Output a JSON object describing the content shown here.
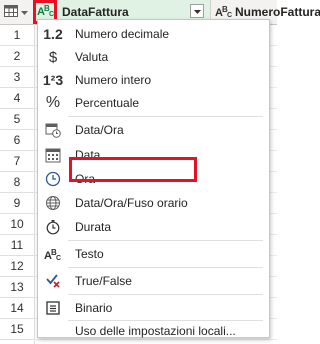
{
  "columns": {
    "datafattura": {
      "type_glyph": "A B C",
      "title": "DataFattura"
    },
    "numero": {
      "type_glyph": "ABC",
      "title": "NumeroFattura"
    }
  },
  "rows": [
    "1",
    "2",
    "3",
    "4",
    "5",
    "6",
    "7",
    "8",
    "9",
    "10",
    "11",
    "12",
    "13",
    "14",
    "15"
  ],
  "menu": {
    "items": [
      {
        "label": "Numero decimale",
        "icon": "decimal-icon",
        "glyph": "1.2"
      },
      {
        "label": "Valuta",
        "icon": "currency-icon",
        "glyph": "$"
      },
      {
        "label": "Numero intero",
        "icon": "integer-icon",
        "glyph": "1²3"
      },
      {
        "label": "Percentuale",
        "icon": "percent-icon",
        "glyph": "%"
      },
      {
        "label": "Data/Ora",
        "icon": "datetime-icon",
        "glyph": ""
      },
      {
        "label": "Data",
        "icon": "calendar-icon",
        "glyph": ""
      },
      {
        "label": "Ora",
        "icon": "clock-icon",
        "glyph": ""
      },
      {
        "label": "Data/Ora/Fuso orario",
        "icon": "globe-icon",
        "glyph": ""
      },
      {
        "label": "Durata",
        "icon": "stopwatch-icon",
        "glyph": ""
      },
      {
        "label": "Testo",
        "icon": "text-type-icon",
        "glyph": "ABC"
      },
      {
        "label": "True/False",
        "icon": "true-false-icon",
        "glyph": ""
      },
      {
        "label": "Binario",
        "icon": "binary-icon",
        "glyph": ""
      },
      {
        "label": "Uso delle impostazioni locali...",
        "icon": "",
        "glyph": ""
      }
    ]
  },
  "colors": {
    "highlight": "#e81123",
    "header_selected": "#dff2e4",
    "accent_green": "#107c41"
  }
}
